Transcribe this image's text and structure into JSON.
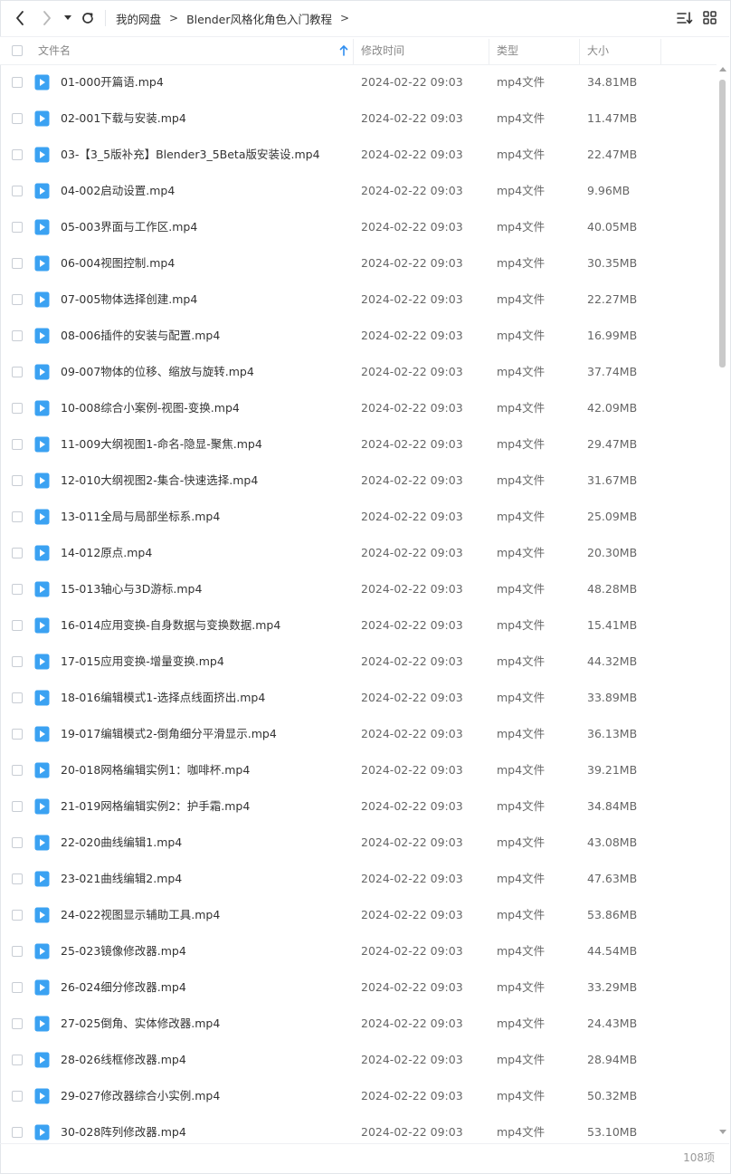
{
  "toolbar": {
    "back_icon": "chevron-left-icon",
    "forward_icon": "chevron-right-icon",
    "history_icon": "caret-down-icon",
    "refresh_icon": "refresh-icon",
    "sort_icon": "sort-list-icon",
    "grid_icon": "grid-view-icon"
  },
  "breadcrumb": {
    "root": "我的网盘",
    "current": "Blender风格化角色入门教程",
    "separator": ">"
  },
  "header": {
    "name": "文件名",
    "modified": "修改时间",
    "type": "类型",
    "size": "大小",
    "sort_direction": "ascending"
  },
  "files": [
    {
      "name": "01-000开篇语.mp4",
      "modified": "2024-02-22 09:03",
      "type": "mp4文件",
      "size": "34.81MB"
    },
    {
      "name": "02-001下载与安装.mp4",
      "modified": "2024-02-22 09:03",
      "type": "mp4文件",
      "size": "11.47MB"
    },
    {
      "name": "03-【3_5版补充】Blender3_5Beta版安装设.mp4",
      "modified": "2024-02-22 09:03",
      "type": "mp4文件",
      "size": "22.47MB"
    },
    {
      "name": "04-002启动设置.mp4",
      "modified": "2024-02-22 09:03",
      "type": "mp4文件",
      "size": "9.96MB"
    },
    {
      "name": "05-003界面与工作区.mp4",
      "modified": "2024-02-22 09:03",
      "type": "mp4文件",
      "size": "40.05MB"
    },
    {
      "name": "06-004视图控制.mp4",
      "modified": "2024-02-22 09:03",
      "type": "mp4文件",
      "size": "30.35MB"
    },
    {
      "name": "07-005物体选择创建.mp4",
      "modified": "2024-02-22 09:03",
      "type": "mp4文件",
      "size": "22.27MB"
    },
    {
      "name": "08-006插件的安装与配置.mp4",
      "modified": "2024-02-22 09:03",
      "type": "mp4文件",
      "size": "16.99MB"
    },
    {
      "name": "09-007物体的位移、缩放与旋转.mp4",
      "modified": "2024-02-22 09:03",
      "type": "mp4文件",
      "size": "37.74MB"
    },
    {
      "name": "10-008综合小案例-视图-变换.mp4",
      "modified": "2024-02-22 09:03",
      "type": "mp4文件",
      "size": "42.09MB"
    },
    {
      "name": "11-009大纲视图1-命名-隐显-聚焦.mp4",
      "modified": "2024-02-22 09:03",
      "type": "mp4文件",
      "size": "29.47MB"
    },
    {
      "name": "12-010大纲视图2-集合-快速选择.mp4",
      "modified": "2024-02-22 09:03",
      "type": "mp4文件",
      "size": "31.67MB"
    },
    {
      "name": "13-011全局与局部坐标系.mp4",
      "modified": "2024-02-22 09:03",
      "type": "mp4文件",
      "size": "25.09MB"
    },
    {
      "name": "14-012原点.mp4",
      "modified": "2024-02-22 09:03",
      "type": "mp4文件",
      "size": "20.30MB"
    },
    {
      "name": "15-013轴心与3D游标.mp4",
      "modified": "2024-02-22 09:03",
      "type": "mp4文件",
      "size": "48.28MB"
    },
    {
      "name": "16-014应用变换-自身数据与变换数据.mp4",
      "modified": "2024-02-22 09:03",
      "type": "mp4文件",
      "size": "15.41MB"
    },
    {
      "name": "17-015应用变换-增量变换.mp4",
      "modified": "2024-02-22 09:03",
      "type": "mp4文件",
      "size": "44.32MB"
    },
    {
      "name": "18-016编辑模式1-选择点线面挤出.mp4",
      "modified": "2024-02-22 09:03",
      "type": "mp4文件",
      "size": "33.89MB"
    },
    {
      "name": "19-017编辑模式2-倒角细分平滑显示.mp4",
      "modified": "2024-02-22 09:03",
      "type": "mp4文件",
      "size": "36.13MB"
    },
    {
      "name": "20-018网格编辑实例1：咖啡杯.mp4",
      "modified": "2024-02-22 09:03",
      "type": "mp4文件",
      "size": "39.21MB"
    },
    {
      "name": "21-019网格编辑实例2：护手霜.mp4",
      "modified": "2024-02-22 09:03",
      "type": "mp4文件",
      "size": "34.84MB"
    },
    {
      "name": "22-020曲线编辑1.mp4",
      "modified": "2024-02-22 09:03",
      "type": "mp4文件",
      "size": "43.08MB"
    },
    {
      "name": "23-021曲线编辑2.mp4",
      "modified": "2024-02-22 09:03",
      "type": "mp4文件",
      "size": "47.63MB"
    },
    {
      "name": "24-022视图显示辅助工具.mp4",
      "modified": "2024-02-22 09:03",
      "type": "mp4文件",
      "size": "53.86MB"
    },
    {
      "name": "25-023镜像修改器.mp4",
      "modified": "2024-02-22 09:03",
      "type": "mp4文件",
      "size": "44.54MB"
    },
    {
      "name": "26-024细分修改器.mp4",
      "modified": "2024-02-22 09:03",
      "type": "mp4文件",
      "size": "33.29MB"
    },
    {
      "name": "27-025倒角、实体修改器.mp4",
      "modified": "2024-02-22 09:03",
      "type": "mp4文件",
      "size": "24.43MB"
    },
    {
      "name": "28-026线框修改器.mp4",
      "modified": "2024-02-22 09:03",
      "type": "mp4文件",
      "size": "28.94MB"
    },
    {
      "name": "29-027修改器综合小实例.mp4",
      "modified": "2024-02-22 09:03",
      "type": "mp4文件",
      "size": "50.32MB"
    },
    {
      "name": "30-028阵列修改器.mp4",
      "modified": "2024-02-22 09:03",
      "type": "mp4文件",
      "size": "53.10MB"
    }
  ],
  "footer": {
    "item_count": "108项"
  },
  "colors": {
    "file_icon": "#3ba2f2",
    "sort_arrow": "#2f8ef0",
    "text": "#333333",
    "muted": "#666666"
  }
}
